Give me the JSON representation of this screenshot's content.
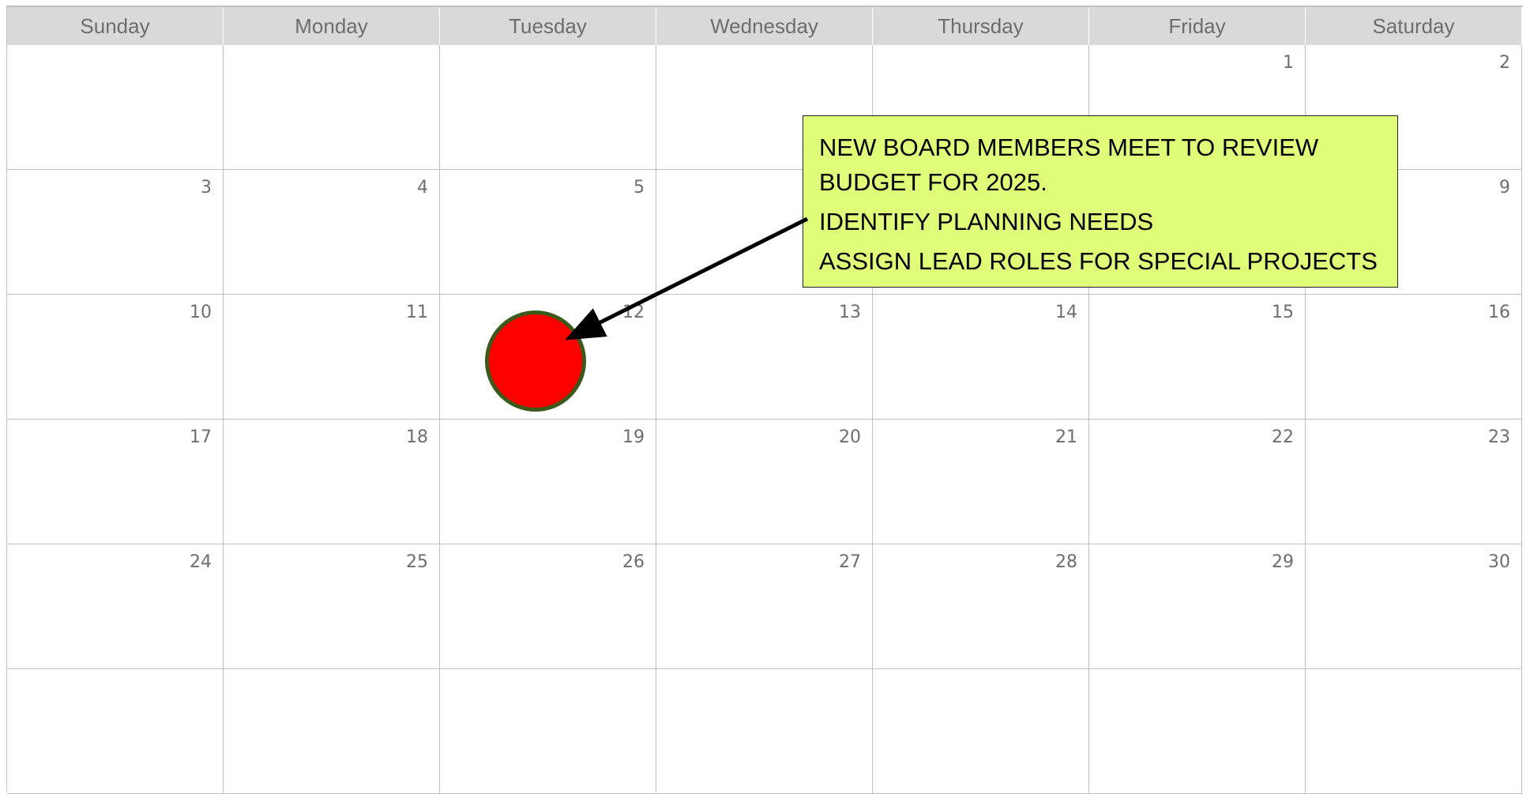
{
  "calendar": {
    "weekdays": [
      "Sunday",
      "Monday",
      "Tuesday",
      "Wednesday",
      "Thursday",
      "Friday",
      "Saturday"
    ],
    "weeks": [
      [
        "",
        "",
        "",
        "",
        "",
        "1",
        "2"
      ],
      [
        "3",
        "4",
        "5",
        "",
        "",
        "",
        "9"
      ],
      [
        "10",
        "11",
        "12",
        "13",
        "14",
        "15",
        "16"
      ],
      [
        "17",
        "18",
        "19",
        "20",
        "21",
        "22",
        "23"
      ],
      [
        "24",
        "25",
        "26",
        "27",
        "28",
        "29",
        "30"
      ],
      [
        "",
        "",
        "",
        "",
        "",
        "",
        ""
      ]
    ]
  },
  "note": {
    "lines": [
      "NEW BOARD MEMBERS MEET TO REVIEW",
      "BUDGET FOR 2025.",
      "IDENTIFY PLANNING NEEDS",
      "ASSIGN LEAD ROLES FOR SPECIAL PROJECTS"
    ],
    "background_color": "#e0fd7a"
  },
  "marker": {
    "color": "#ff0000",
    "border_color": "#3b5a1a"
  }
}
